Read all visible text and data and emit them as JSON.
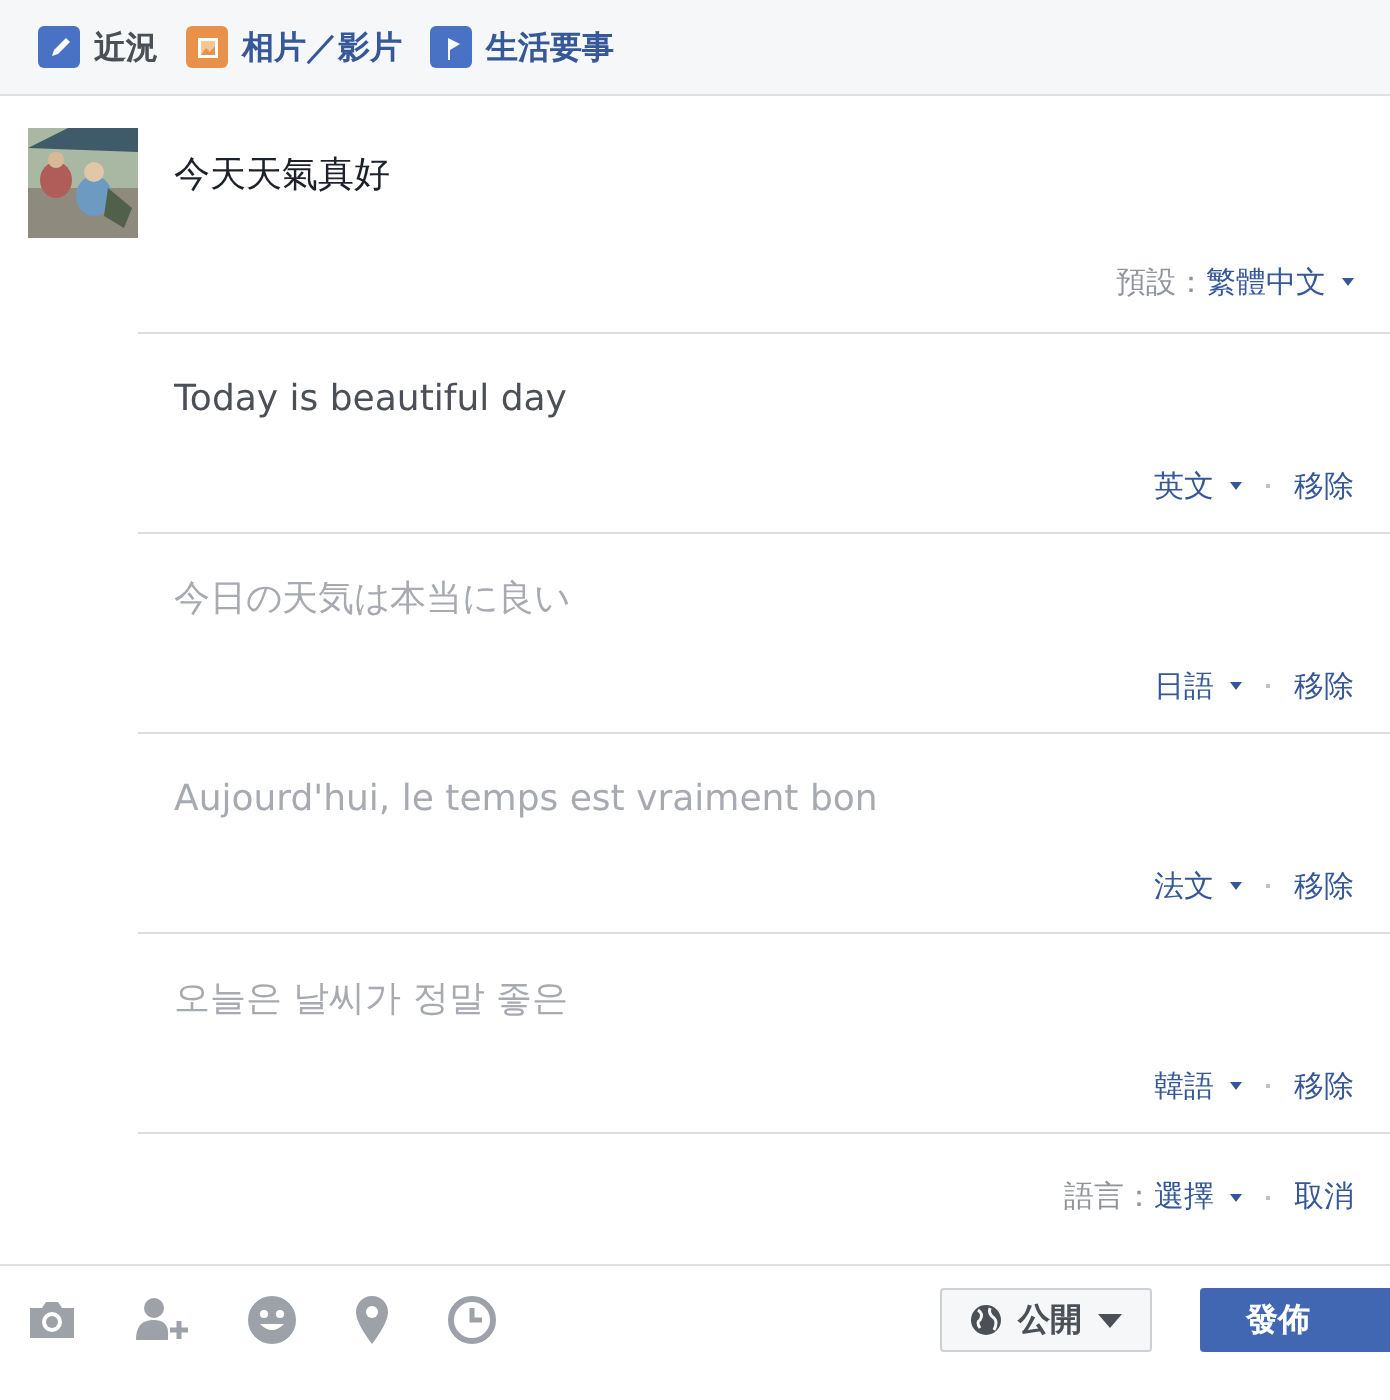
{
  "tabs": [
    {
      "label": "近況",
      "selected": true,
      "kind": "status"
    },
    {
      "label": "相片／影片",
      "selected": false
    },
    {
      "label": "生活要事",
      "selected": false,
      "kind": "event"
    }
  ],
  "status_text": "今天天氣真好",
  "default_language": {
    "label": "預設：",
    "value": "繁體中文"
  },
  "translations": [
    {
      "value": "Today is beautiful day",
      "language": "英文",
      "remove": "移除"
    },
    {
      "placeholder": "今日の天気は本当に良い",
      "language": "日語",
      "remove": "移除"
    },
    {
      "placeholder": "Aujourd'hui, le temps est vraiment bon",
      "language": "法文",
      "remove": "移除"
    },
    {
      "placeholder": "오늘은 날씨가 정말 좋은",
      "language": "韓語",
      "remove": "移除"
    }
  ],
  "language_picker": {
    "label": "語言：",
    "value": "選擇",
    "cancel": "取消"
  },
  "toolbar": {
    "icons": [
      {
        "kind": "camera"
      },
      {
        "kind": "tag-person"
      },
      {
        "kind": "feeling"
      },
      {
        "kind": "location"
      },
      {
        "kind": "clock"
      }
    ],
    "audience": "公開",
    "post": "發佈"
  }
}
